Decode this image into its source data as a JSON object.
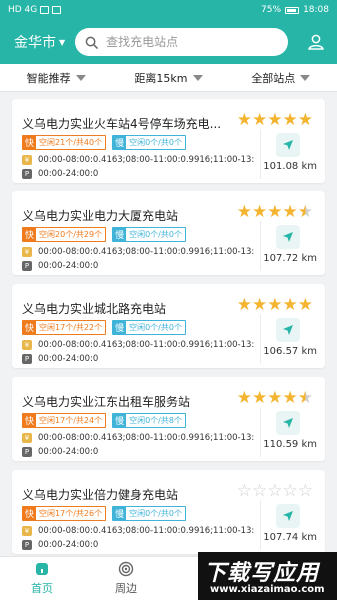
{
  "status_bar": {
    "left": "HD 4G",
    "right_battery": "75%",
    "time": "18:08"
  },
  "header": {
    "city": "金华市",
    "search_placeholder": "查找充电站点"
  },
  "filters": [
    "智能推荐",
    "距离15km",
    "全部站点"
  ],
  "stations": [
    {
      "name": "义乌电力实业火车站4号停车场充电...",
      "rating": 5,
      "fast": {
        "key": "快",
        "value": "空闲21个/共40个"
      },
      "slow": {
        "key": "慢",
        "value": "空闲0个/共0个"
      },
      "price": "00:00-08:00:0.4163;08:00-11:00:0.9916;11:00-13:...",
      "parking": "00:00-24:00:0",
      "distance": "101.08 km"
    },
    {
      "name": "义乌电力实业电力大厦充电站",
      "rating": 4.5,
      "fast": {
        "key": "快",
        "value": "空闲20个/共29个"
      },
      "slow": {
        "key": "慢",
        "value": "空闲0个/共0个"
      },
      "price": "00:00-08:00:0.4163;08:00-11:00:0.9916;11:00-13:...",
      "parking": "00:00-24:00:0",
      "distance": "107.72 km"
    },
    {
      "name": "义乌电力实业城北路充电站",
      "rating": 5,
      "fast": {
        "key": "快",
        "value": "空闲17个/共22个"
      },
      "slow": {
        "key": "慢",
        "value": "空闲0个/共0个"
      },
      "price": "00:00-08:00:0.4163;08:00-11:00:0.9916;11:00-13:...",
      "parking": "00:00-24:00:0",
      "distance": "106.57 km"
    },
    {
      "name": "义乌电力实业江东出租车服务站",
      "rating": 4.5,
      "fast": {
        "key": "快",
        "value": "空闲17个/共24个"
      },
      "slow": {
        "key": "慢",
        "value": "空闲0个/共8个"
      },
      "price": "00:00-08:00:0.4163;08:00-11:00:0.9916;11:00-13:...",
      "parking": "00:00-24:00:0",
      "distance": "110.59 km"
    },
    {
      "name": "义乌电力实业倍力健身充电站",
      "rating": 0,
      "fast": {
        "key": "快",
        "value": "空闲17个/共26个"
      },
      "slow": {
        "key": "慢",
        "value": "空闲0个/共0个"
      },
      "price": "00:00-08:00:0.4163;08:00-11:00:0.9916;11:00-13:...",
      "parking": "00:00-24:00:0",
      "distance": "107.74 km"
    }
  ],
  "tabs": [
    "首页",
    "周边"
  ],
  "watermark": {
    "top": "下载写应用",
    "bottom": "www.xiazaimao.com"
  },
  "colors": {
    "primary": "#26b5a6",
    "fast": "#f07b1d",
    "slow": "#3fb3d8",
    "star": "#f3b430"
  }
}
